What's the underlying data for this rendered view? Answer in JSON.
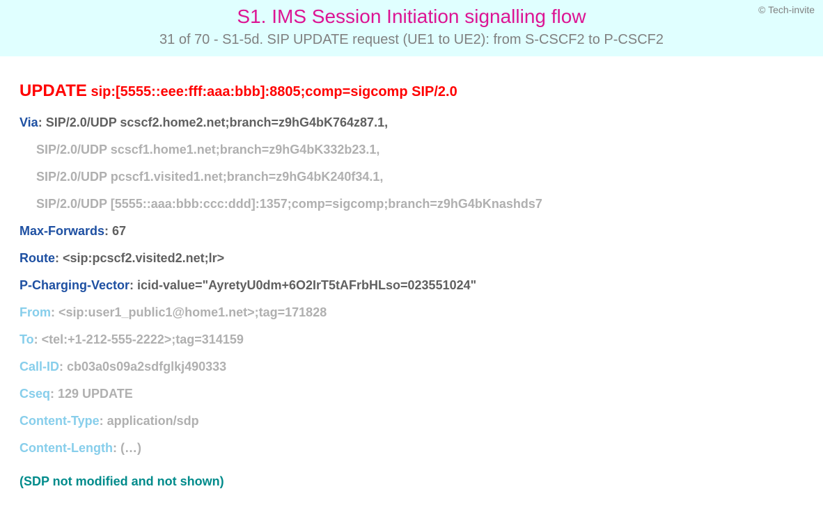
{
  "header": {
    "copyright": "© Tech-invite",
    "title": "S1. IMS Session Initiation signalling flow",
    "subtitle": "31 of 70 - S1-5d. SIP UPDATE request (UE1 to UE2): from S-CSCF2 to P-CSCF2"
  },
  "request": {
    "method": "UPDATE",
    "uri": "sip:[5555::eee:fff:aaa:bbb]:8805;comp=sigcomp SIP/2.0"
  },
  "headers": {
    "via": {
      "name": "Via",
      "first": ": SIP/2.0/UDP scscf2.home2.net;branch=z9hG4bK764z87.1,",
      "rest": [
        "SIP/2.0/UDP scscf1.home1.net;branch=z9hG4bK332b23.1,",
        "SIP/2.0/UDP pcscf1.visited1.net;branch=z9hG4bK240f34.1,",
        "SIP/2.0/UDP [5555::aaa:bbb:ccc:ddd]:1357;comp=sigcomp;branch=z9hG4bKnashds7"
      ]
    },
    "maxforwards": {
      "name": "Max-Forwards",
      "value": ": 67"
    },
    "route": {
      "name": "Route",
      "value": ": <sip:pcscf2.visited2.net;lr>"
    },
    "pcharging": {
      "name": "P-Charging-Vector",
      "value": ": icid-value=\"AyretyU0dm+6O2IrT5tAFrbHLso=023551024\""
    },
    "from": {
      "name": "From",
      "value": ": <sip:user1_public1@home1.net>;tag=171828"
    },
    "to": {
      "name": "To",
      "value": ": <tel:+1-212-555-2222>;tag=314159"
    },
    "callid": {
      "name": "Call-ID",
      "value": ": cb03a0s09a2sdfglkj490333"
    },
    "cseq": {
      "name": "Cseq",
      "value": ": 129 UPDATE"
    },
    "ctype": {
      "name": "Content-Type",
      "value": ": application/sdp"
    },
    "clen": {
      "name": "Content-Length",
      "value": ": (…)"
    }
  },
  "sdp_note": "(SDP not modified and not shown)"
}
